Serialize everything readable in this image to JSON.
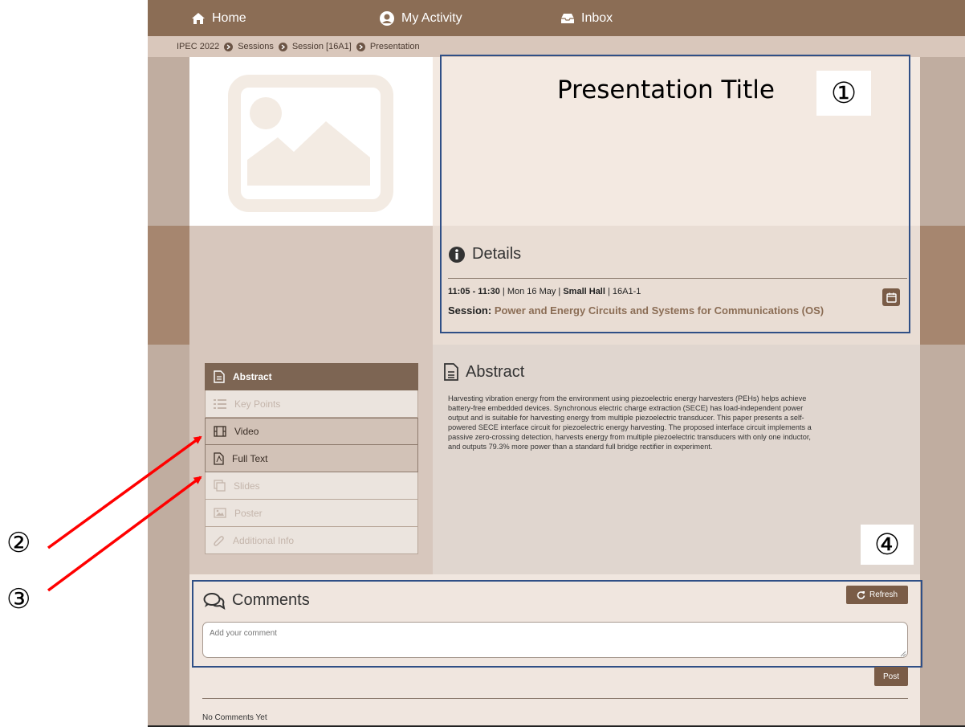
{
  "nav": {
    "home_label": "Home",
    "activity_label": "My Activity",
    "inbox_label": "Inbox"
  },
  "breadcrumb": [
    "IPEC 2022",
    "Sessions",
    "Session [16A1]",
    "Presentation"
  ],
  "presentation": {
    "title": "Presentation Title"
  },
  "details": {
    "heading": "Details",
    "time": "11:05 - 11:30",
    "sep1": " | ",
    "date": "Mon 16 May",
    "sep2": " | ",
    "room": "Small Hall",
    "sep3": " | ",
    "code": "16A1-1",
    "session_label": "Session:",
    "session_name": "Power and Energy Circuits and Systems for Communications (OS)"
  },
  "menu": {
    "items": [
      {
        "label": "Abstract",
        "icon": "document-icon",
        "state": "active"
      },
      {
        "label": "Key Points",
        "icon": "list-icon",
        "state": "disabled"
      },
      {
        "label": "Video",
        "icon": "film-icon",
        "state": "enabled"
      },
      {
        "label": "Full Text",
        "icon": "pdf-icon",
        "state": "enabled"
      },
      {
        "label": "Slides",
        "icon": "slides-icon",
        "state": "disabled"
      },
      {
        "label": "Poster",
        "icon": "image-icon",
        "state": "disabled"
      },
      {
        "label": "Additional Info",
        "icon": "paperclip-icon",
        "state": "disabled"
      }
    ]
  },
  "abstract": {
    "heading": "Abstract",
    "lines": [
      "Harvesting vibration energy from the environment using piezoelectric energy harvesters (PEHs) helps achieve",
      "battery-free embedded devices. Synchronous electric charge extraction (SECE) has load-independent power",
      "output and is suitable for harvesting energy from multiple piezoelectric transducer. This paper presents a self-",
      "powered SECE interface circuit for piezoelectric energy harvesting. The proposed interface circuit implements a",
      "passive zero-crossing detection, harvests energy from multiple piezoelectric transducers with only one inductor,",
      "and outputs 79.3% more power than a standard full bridge rectifier in experiment."
    ]
  },
  "comments": {
    "heading": "Comments",
    "refresh_label": "Refresh",
    "placeholder": "Add your comment",
    "post_label": "Post",
    "empty_text": "No Comments Yet"
  },
  "annotations": {
    "callout_1": "①",
    "callout_2": "②",
    "callout_3": "③",
    "callout_4": "④"
  },
  "colors": {
    "nav_bg": "#8b6d55",
    "accent": "#7a5c47",
    "outline_blue": "#2f4f86",
    "arrow_red": "#ff0000"
  }
}
